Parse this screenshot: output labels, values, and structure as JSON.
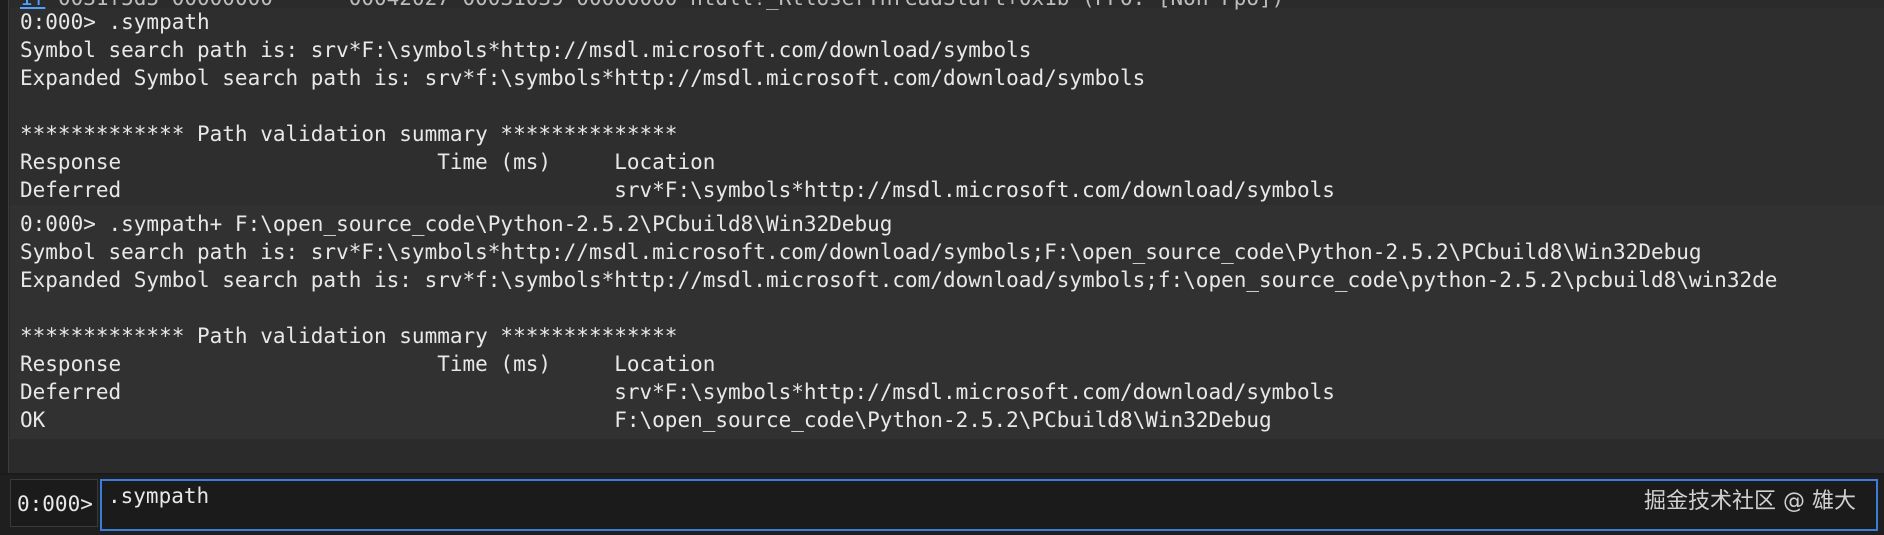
{
  "output": {
    "top_partial_line_prefix": "1f",
    "top_partial_line_rest": " 0031f5d5 00000000      00042027 00031039 00000000 ntdll!_RtlUserThreadStart+0x1b (FPO: [Non-Fpo])",
    "lines": [
      "0:000> .sympath",
      "Symbol search path is: srv*F:\\symbols*http://msdl.microsoft.com/download/symbols",
      "Expanded Symbol search path is: srv*f:\\symbols*http://msdl.microsoft.com/download/symbols",
      "",
      "************* Path validation summary **************",
      "Response                         Time (ms)     Location",
      "Deferred                                       srv*F:\\symbols*http://msdl.microsoft.com/download/symbols",
      "0:000> .sympath+ F:\\open_source_code\\Python-2.5.2\\PCbuild8\\Win32Debug",
      "Symbol search path is: srv*F:\\symbols*http://msdl.microsoft.com/download/symbols;F:\\open_source_code\\Python-2.5.2\\PCbuild8\\Win32Debug",
      "Expanded Symbol search path is: srv*f:\\symbols*http://msdl.microsoft.com/download/symbols;f:\\open_source_code\\python-2.5.2\\pcbuild8\\win32de",
      "",
      "************* Path validation summary **************",
      "Response                         Time (ms)     Location",
      "Deferred                                       srv*F:\\symbols*http://msdl.microsoft.com/download/symbols",
      "OK                                             F:\\open_source_code\\Python-2.5.2\\PCbuild8\\Win32Debug"
    ]
  },
  "command_bar": {
    "prompt": "0:000>",
    "input_value": ".sympath",
    "input_placeholder": ""
  },
  "watermark": "掘金技术社区 @ 雄大",
  "colors": {
    "background": "#2b2b2b",
    "text": "#e8e8e8",
    "input_border": "#3b7dd8",
    "link": "#4ea1ff"
  }
}
